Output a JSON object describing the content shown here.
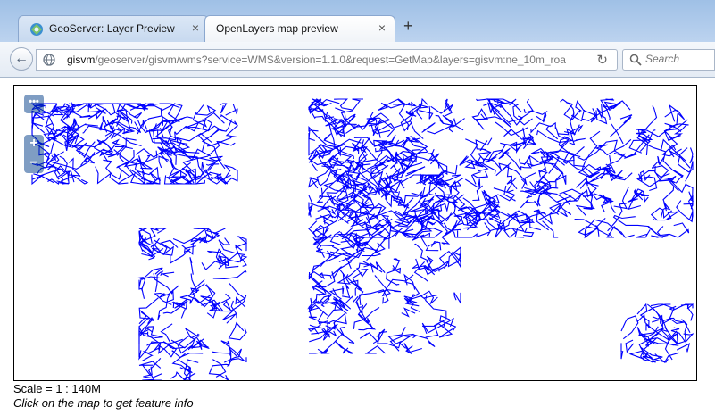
{
  "browser": {
    "tabs": [
      {
        "label": "GeoServer: Layer Preview",
        "close": "×"
      },
      {
        "label": "OpenLayers map preview",
        "close": "×"
      }
    ],
    "new_tab": "+",
    "back_glyph": "←",
    "reload_glyph": "↻",
    "url_host": "gisvm",
    "url_path": "/geoserver/gisvm/wms?service=WMS&version=1.1.0&request=GetMap&layers=gisvm:ne_10m_roa",
    "search_placeholder": "Search"
  },
  "map": {
    "controls": {
      "layers": "•••",
      "zoom_in": "+",
      "zoom_out": "−"
    },
    "road_color": "#0000ff"
  },
  "footer": {
    "scale_text": "Scale = 1 : 140M",
    "hint_text": "Click on the map to get feature info"
  }
}
